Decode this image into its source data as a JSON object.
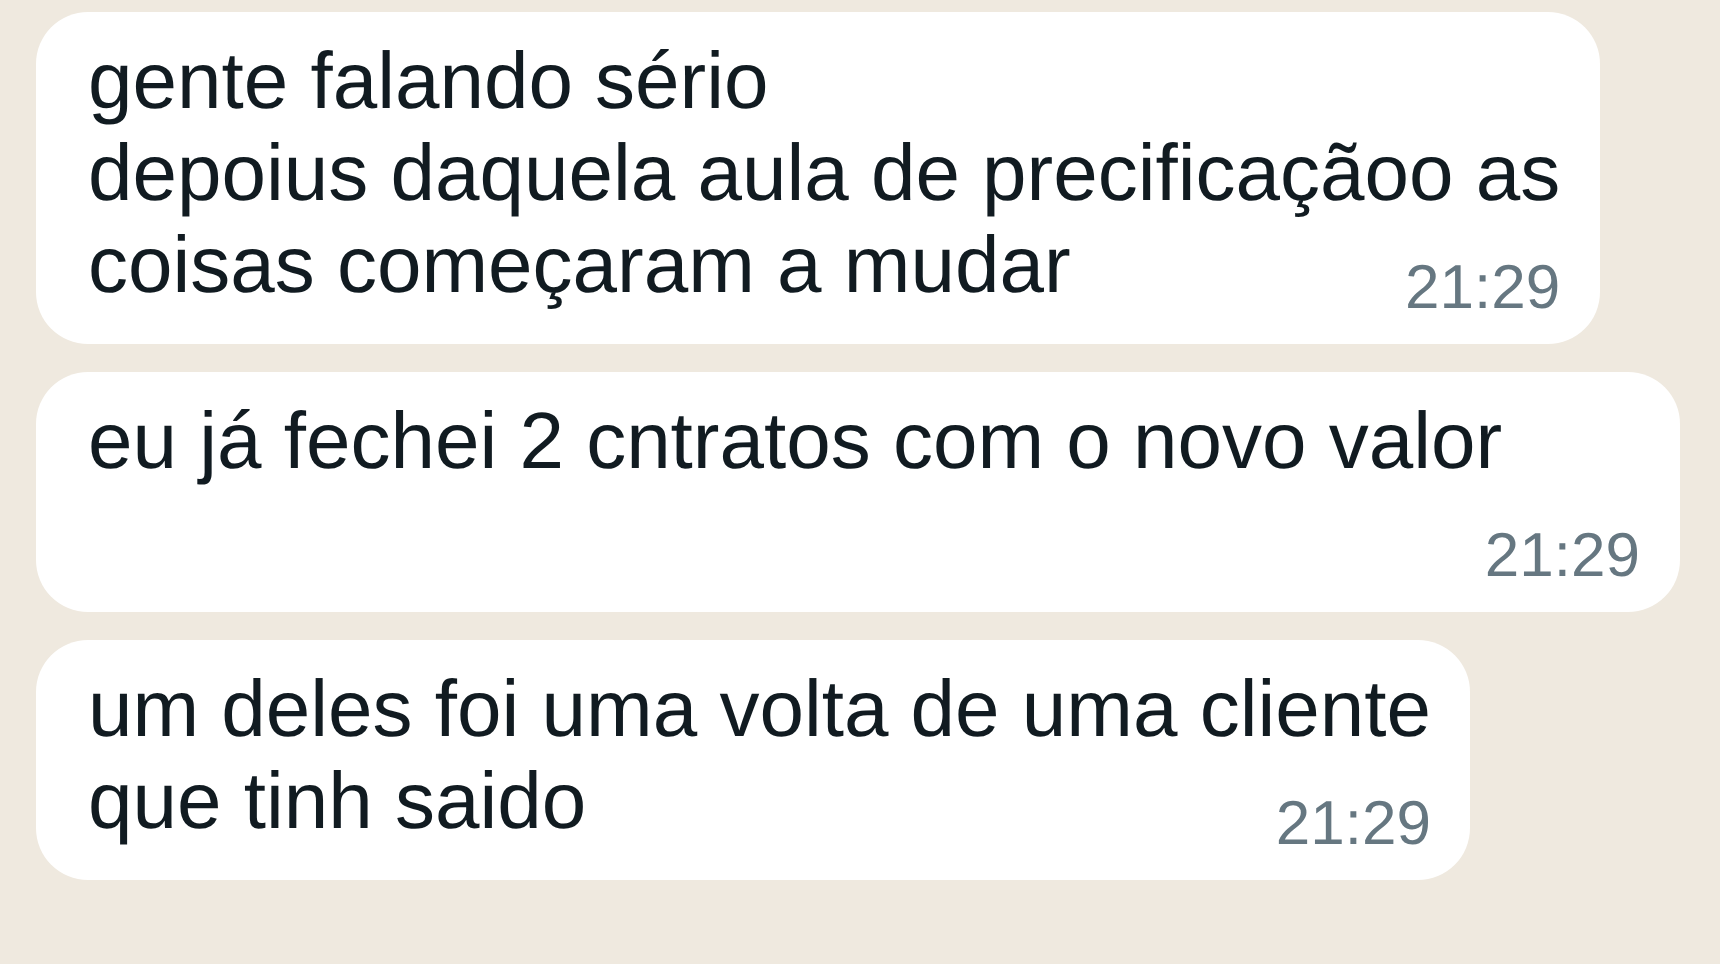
{
  "messages": [
    {
      "lines": [
        "gente falando sério",
        "depoius daquela aula de precificaçãoo as",
        "coisas começaram a mudar"
      ],
      "time": "21:29"
    },
    {
      "lines": [
        "eu já fechei 2 cntratos com o novo valor"
      ],
      "time": "21:29"
    },
    {
      "lines": [
        "um deles foi uma volta de uma cliente",
        "que tinh saido"
      ],
      "time": "21:29"
    }
  ]
}
